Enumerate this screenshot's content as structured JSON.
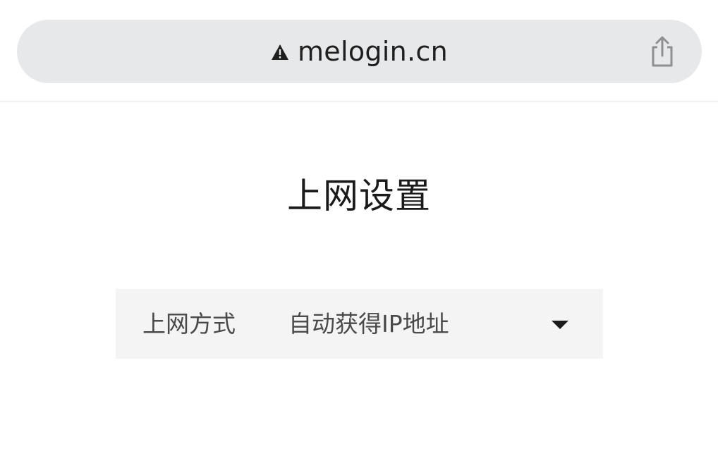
{
  "browser": {
    "url": "melogin.cn",
    "security_icon": "warning-triangle-icon",
    "share_icon": "share-icon"
  },
  "page": {
    "title": "上网设置"
  },
  "connection": {
    "label": "上网方式",
    "selected_value": "自动获得IP地址",
    "dropdown_icon": "caret-down-icon"
  },
  "colors": {
    "address_bar_bg": "#e7e8ea",
    "row_bg": "#f4f4f4",
    "text_dark": "#1a1a1a",
    "text_muted": "#4a4a4a"
  }
}
